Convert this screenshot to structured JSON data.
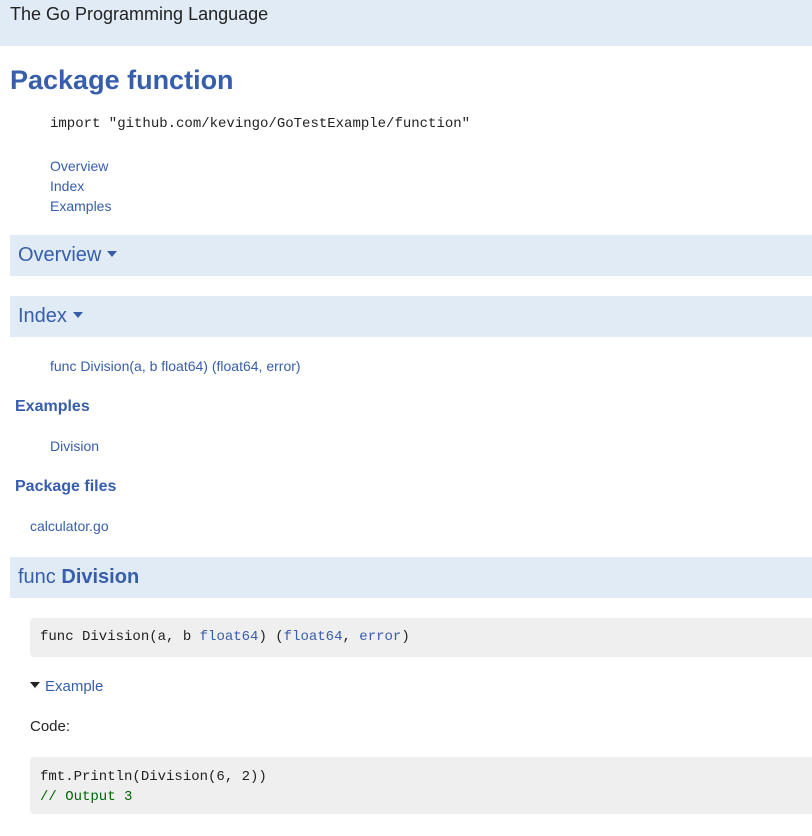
{
  "topbar": {
    "title": "The Go Programming Language"
  },
  "page": {
    "title": "Package function"
  },
  "import_line": "import \"github.com/kevingo/GoTestExample/function\"",
  "toc": {
    "items": [
      "Overview",
      "Index",
      "Examples"
    ]
  },
  "sections": {
    "overview": "Overview",
    "index": "Index",
    "func_prefix": "func",
    "func_name": "Division"
  },
  "index": {
    "funcs": [
      "func Division(a, b float64) (float64, error)"
    ],
    "examples_heading": "Examples",
    "examples": [
      "Division"
    ],
    "files_heading": "Package files",
    "files": [
      "calculator.go"
    ]
  },
  "func_division": {
    "sig_prefix": "func Division(a, b ",
    "type1": "float64",
    "sig_mid": ") (",
    "type2": "float64",
    "sig_sep": ", ",
    "type3": "error",
    "sig_end": ")",
    "example_toggle": "Example",
    "code_label": "Code:",
    "example_code_line": "fmt.Println(Division(6, 2))",
    "example_comment": "// Output 3"
  },
  "colors": {
    "link": "#375eab",
    "bar_bg": "#e0ebf5",
    "code_bg": "#efefef",
    "comment": "#006600"
  },
  "icons": {
    "section_toggle": "caret-down-icon",
    "example_toggle": "caret-down-icon"
  }
}
